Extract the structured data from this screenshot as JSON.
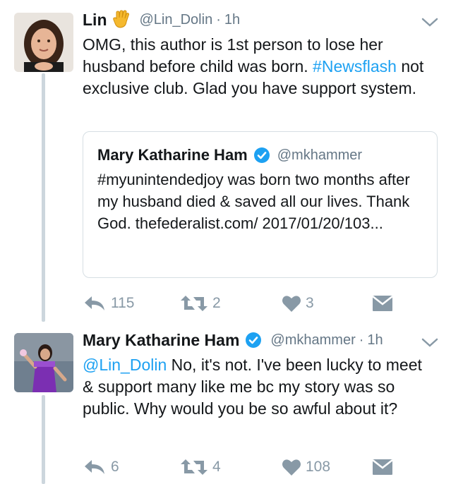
{
  "tweets": [
    {
      "name": "Lin",
      "emoji": "vulcan-salute",
      "handle": "@Lin_Dolin",
      "time": "1h",
      "text_before": "OMG, this author is 1st person to lose her husband before child was born. ",
      "hashtag": "#Newsflash",
      "text_after": " not exclusive club. Glad you have support system.",
      "quote": {
        "name": "Mary Katharine Ham",
        "handle": "@mkhammer",
        "text": "#myunintendedjoy was born two months after my husband died & saved all our lives. Thank God. thefederalist.com/ 2017/01/20/103..."
      },
      "actions": {
        "reply": "115",
        "retweet": "2",
        "like": "3"
      }
    },
    {
      "name": "Mary Katharine Ham",
      "handle": "@mkhammer",
      "time": "1h",
      "mention": "@Lin_Dolin",
      "text": " No, it's not. I've been lucky to meet & support many like me bc my story was so public. Why would you be so awful about it?",
      "actions": {
        "reply": "6",
        "retweet": "4",
        "like": "108"
      }
    }
  ],
  "colors": {
    "link": "#1da1f2",
    "muted": "#657786",
    "icon": "#8899a6",
    "verified": "#1da1f2",
    "thread_line": "#ccd6dd"
  }
}
